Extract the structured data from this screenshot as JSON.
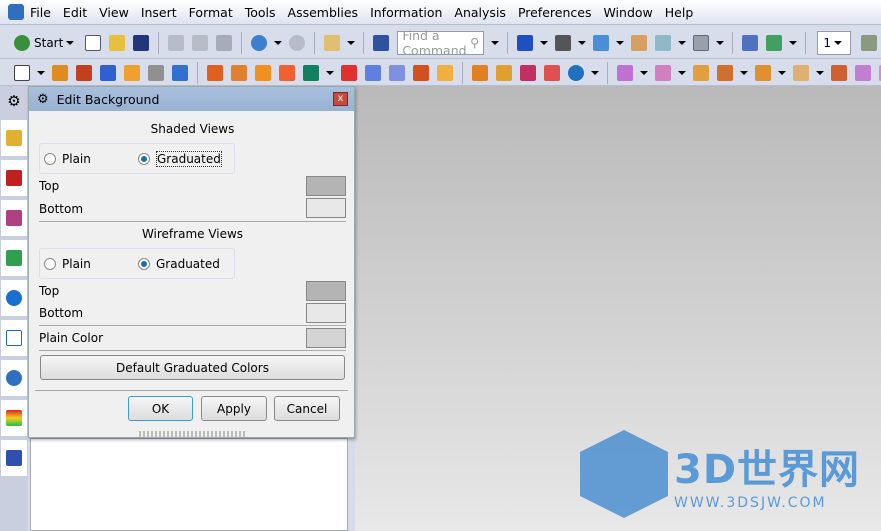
{
  "menubar": {
    "items": [
      "File",
      "Edit",
      "View",
      "Insert",
      "Format",
      "Tools",
      "Assemblies",
      "Information",
      "Analysis",
      "Preferences",
      "Window",
      "Help"
    ]
  },
  "toolbar": {
    "start_label": "Start",
    "search_placeholder": "Find a Command",
    "layer_value": "1"
  },
  "dialog": {
    "title": "Edit Background",
    "shaded_title": "Shaded Views",
    "wire_title": "Wireframe Views",
    "plain": "Plain",
    "graduated": "Graduated",
    "shaded_selected": "Graduated",
    "wire_selected": "Graduated",
    "top": "Top",
    "bottom": "Bottom",
    "plain_color": "Plain Color",
    "colors": {
      "shaded_top": "#b4b4b4",
      "shaded_bottom": "#e8e8e8",
      "wire_top": "#b4b4b4",
      "wire_bottom": "#e8e8e8",
      "plain": "#d4d4d4"
    },
    "default_btn": "Default Graduated Colors",
    "ok": "OK",
    "apply": "Apply",
    "cancel": "Cancel"
  },
  "watermark": {
    "text": "3D世界网",
    "url": "WWW.3DSJW.COM"
  }
}
